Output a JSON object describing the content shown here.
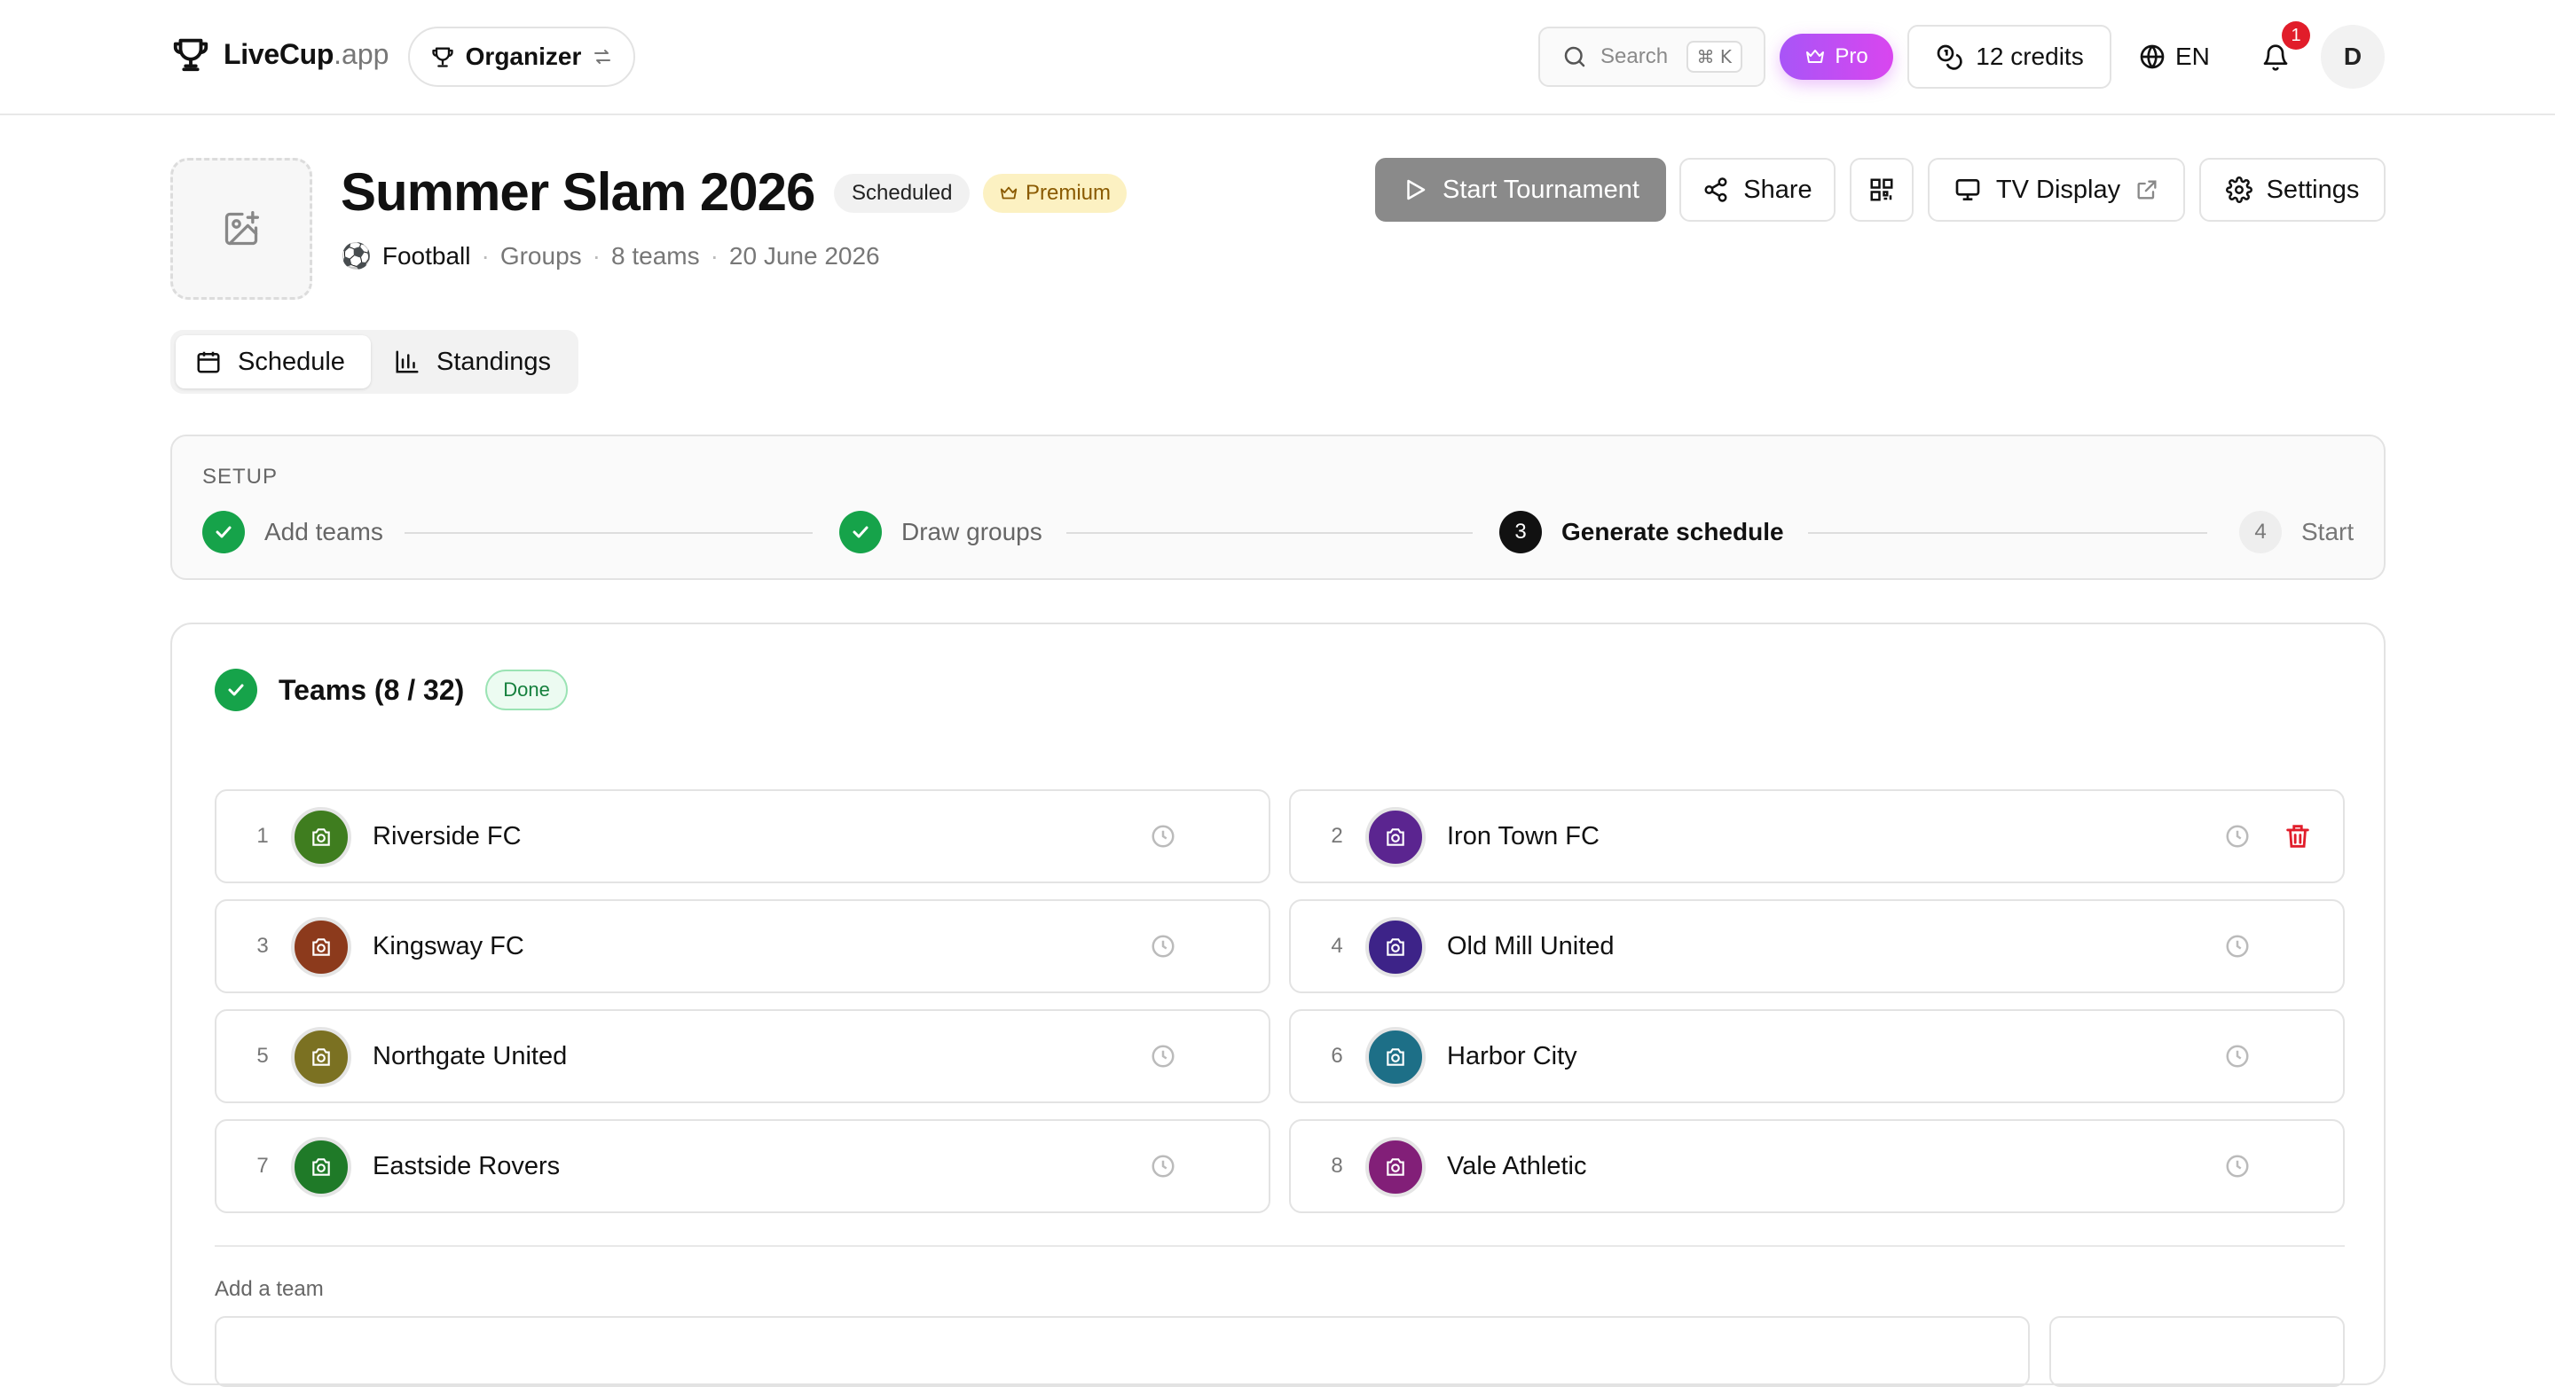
{
  "nav": {
    "brand_name": "LiveCup",
    "brand_tld": ".app",
    "role": "Organizer",
    "search_placeholder": "Search",
    "search_shortcut": "⌘ K",
    "pro_label": "Pro",
    "credits_label": "12 credits",
    "language": "EN",
    "notifications_count": "1",
    "avatar_initial": "D"
  },
  "tournament": {
    "title": "Summer Slam 2026",
    "status": "Scheduled",
    "tier": "Premium",
    "sport_emoji": "⚽",
    "sport": "Football",
    "format": "Groups",
    "teams_count": "8 teams",
    "date": "20 June 2026"
  },
  "actions": {
    "start": "Start Tournament",
    "share": "Share",
    "tv_display": "TV Display",
    "settings": "Settings"
  },
  "tabs": [
    {
      "label": "Schedule",
      "active": true
    },
    {
      "label": "Standings",
      "active": false
    }
  ],
  "setup": {
    "label": "SETUP",
    "steps": [
      {
        "number": "1",
        "label": "Add teams",
        "state": "done"
      },
      {
        "number": "2",
        "label": "Draw groups",
        "state": "done"
      },
      {
        "number": "3",
        "label": "Generate schedule",
        "state": "current"
      },
      {
        "number": "4",
        "label": "Start",
        "state": "upcoming"
      }
    ]
  },
  "teams_section": {
    "title": "Teams (8 / 32)",
    "status": "Done",
    "add_label": "Add a team",
    "teams": [
      {
        "number": "1",
        "name": "Riverside FC",
        "color": "#3f7d1f"
      },
      {
        "number": "2",
        "name": "Iron Town FC",
        "color": "#5b2590"
      },
      {
        "number": "3",
        "name": "Kingsway FC",
        "color": "#8c3a1c"
      },
      {
        "number": "4",
        "name": "Old Mill United",
        "color": "#3d2388"
      },
      {
        "number": "5",
        "name": "Northgate United",
        "color": "#7b7122"
      },
      {
        "number": "6",
        "name": "Harbor City",
        "color": "#1d6f87"
      },
      {
        "number": "7",
        "name": "Eastside Rovers",
        "color": "#1f7a28"
      },
      {
        "number": "8",
        "name": "Vale Athletic",
        "color": "#821f78"
      }
    ]
  },
  "colors": {
    "accent_green": "#16a34a",
    "pro_purple": "#c04fee",
    "danger_red": "#e11d2a",
    "premium_bg": "#fcf1c2"
  }
}
